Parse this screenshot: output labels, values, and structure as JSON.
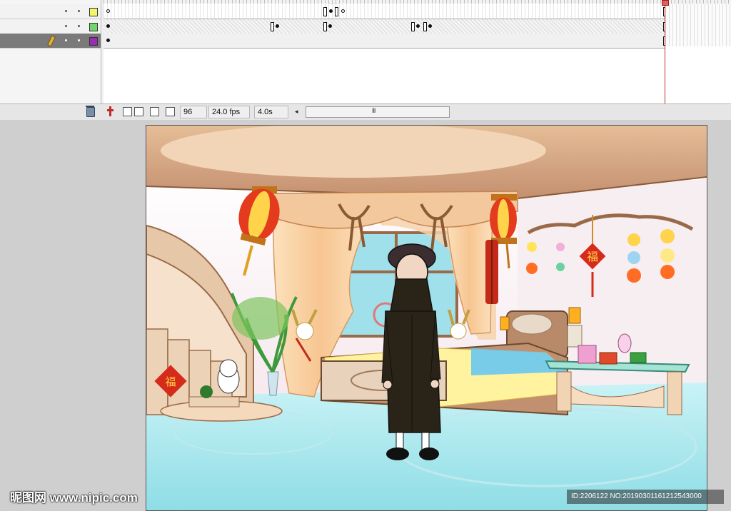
{
  "timeline": {
    "layers": [
      {
        "name": "",
        "color": "#f5f56a"
      },
      {
        "name": "",
        "color": "#6fd66a"
      },
      {
        "name": "",
        "color": "#9b2bb5",
        "selected": true
      }
    ],
    "footer": {
      "current_frame": "96",
      "frame_rate": "24.0 fps",
      "elapsed_time": "4.0s",
      "scroll_left_glyph": "◂",
      "scroll_thumb_glyph": "III"
    }
  },
  "stage": {
    "scene": "cartoon bedroom with lanterns, canopy bed, staircase, cat statue and man in black coat",
    "decorations_text": [
      "福",
      "福"
    ]
  },
  "watermark": {
    "left_text": "昵图网 www.nipic.com",
    "right_text": "ID:2206122 NO:20190301161212543000"
  },
  "colors": {
    "playhead": "#cc2b2b",
    "stage_floor": "#aee8ee",
    "ceiling": "#d4a880",
    "lantern_red": "#e43b1e"
  }
}
